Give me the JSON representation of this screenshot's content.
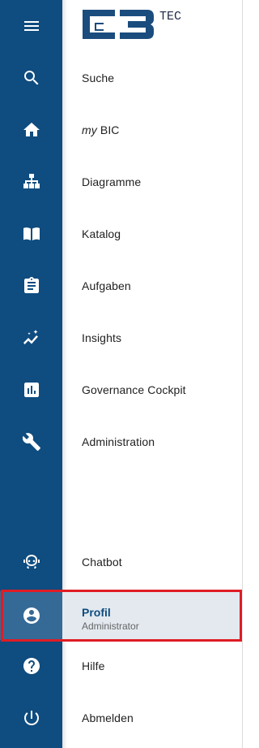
{
  "logo": {
    "mark": "CB",
    "suffix": "TEC"
  },
  "nav": {
    "menu_icon": "menu-icon",
    "items": [
      {
        "icon": "search-icon",
        "label": "Suche"
      },
      {
        "icon": "home-icon",
        "label_prefix": "my",
        "label": "BIC"
      },
      {
        "icon": "sitemap-icon",
        "label": "Diagramme"
      },
      {
        "icon": "book-icon",
        "label": "Katalog"
      },
      {
        "icon": "clipboard-icon",
        "label": "Aufgaben"
      },
      {
        "icon": "insights-icon",
        "label": "Insights"
      },
      {
        "icon": "chart-icon",
        "label": "Governance Cockpit"
      },
      {
        "icon": "wrench-icon",
        "label": "Administration"
      }
    ],
    "bottom_items": [
      {
        "icon": "chatbot-icon",
        "label": "Chatbot"
      },
      {
        "icon": "account-icon",
        "label": "Profil",
        "sublabel": "Administrator"
      },
      {
        "icon": "help-icon",
        "label": "Hilfe"
      },
      {
        "icon": "power-icon",
        "label": "Abmelden"
      }
    ]
  },
  "colors": {
    "rail": "#0f4c7f",
    "active_rail": "#356a97",
    "active_bg": "#e3e9ef",
    "highlight_border": "#e01c24"
  }
}
